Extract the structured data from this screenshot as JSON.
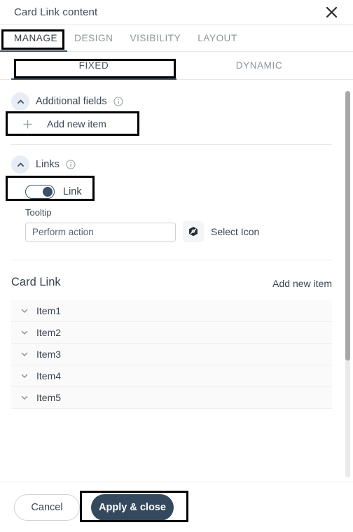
{
  "header": {
    "title": "Card Link content",
    "close_icon": "close-icon"
  },
  "tabs": [
    {
      "label": "MANAGE",
      "active": true
    },
    {
      "label": "DESIGN",
      "active": false
    },
    {
      "label": "VISIBILITY",
      "active": false
    },
    {
      "label": "LAYOUT",
      "active": false
    }
  ],
  "subtabs": [
    {
      "label": "FIXED",
      "active": true
    },
    {
      "label": "DYNAMIC",
      "active": false
    }
  ],
  "sections": {
    "additional_fields": {
      "title": "Additional fields",
      "chevron_icon": "chevron-up-icon",
      "info_icon": "info-icon",
      "add_new_item": "Add new item",
      "plus_icon": "plus-icon"
    },
    "links": {
      "title": "Links",
      "chevron_icon": "chevron-up-icon",
      "info_icon": "info-icon",
      "toggle_label": "Link",
      "toggle_state": "on",
      "tooltip_label": "Tooltip",
      "tooltip_value": "Perform action",
      "tooltip_placeholder": "Perform action",
      "select_icon_label": "Select Icon",
      "select_icon_glyph": "hexagon-slash-icon"
    }
  },
  "card_link": {
    "title": "Card Link",
    "add_new_item": "Add new item",
    "items": [
      {
        "label": "Item1",
        "chevron_icon": "chevron-down-icon"
      },
      {
        "label": "Item2",
        "chevron_icon": "chevron-down-icon"
      },
      {
        "label": "Item3",
        "chevron_icon": "chevron-down-icon"
      },
      {
        "label": "Item4",
        "chevron_icon": "chevron-down-icon"
      },
      {
        "label": "Item5",
        "chevron_icon": "chevron-down-icon"
      }
    ]
  },
  "footer": {
    "cancel_label": "Cancel",
    "apply_label": "Apply & close"
  },
  "colors": {
    "accent_navy": "#34495e",
    "tab_underline": "#3c5166",
    "chevron_bg": "#e8ecf5",
    "annotation": "#000000",
    "muted_text": "#8d949b",
    "body_text": "#3a4552",
    "scrollbar_thumb": "#a8a8a8"
  }
}
